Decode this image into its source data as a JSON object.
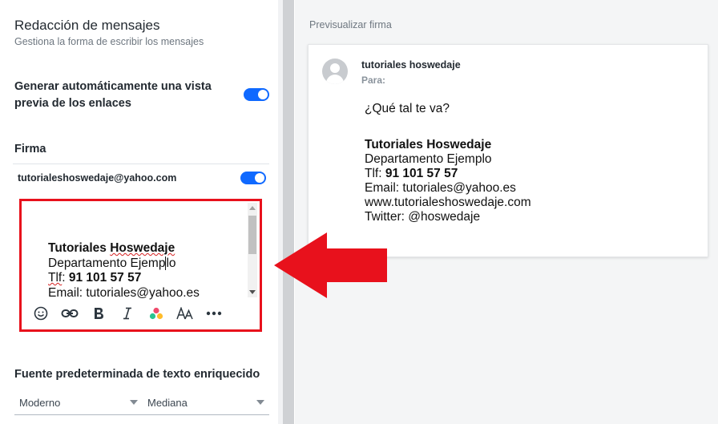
{
  "section": {
    "title": "Redacción de mensajes",
    "subtitle": "Gestiona la forma de escribir los mensajes"
  },
  "link_preview": {
    "label": "Generar automáticamente una vista previa de los enlaces",
    "enabled": true
  },
  "signature": {
    "heading": "Firma",
    "account": "tutorialeshoswedaje@yahoo.com",
    "enabled": true,
    "editor_lines": {
      "name_a": "Tutoriales ",
      "name_b": "Hoswedaje",
      "dept_a": "Departamento Ejemp",
      "dept_b": "lo",
      "phone_label": "Tlf",
      "phone_sep": ": ",
      "phone_value": "91 101 57 57",
      "email": "Email: tutoriales@yahoo.es"
    },
    "toolbar": [
      "emoji-icon",
      "link-icon",
      "bold-icon",
      "italic-icon",
      "color-icon",
      "font-size-icon",
      "more-icon"
    ],
    "highlight_color": "#e8111c"
  },
  "font_defaults": {
    "heading": "Fuente predeterminada de texto enriquecido",
    "family": "Moderno",
    "size": "Mediana"
  },
  "preview": {
    "heading": "Previsualizar firma",
    "from": "tutoriales hoswedaje",
    "to_label": "Para:",
    "greeting": "¿Qué tal te va?",
    "signature": {
      "name": "Tutoriales Hoswedaje",
      "dept": "Departamento Ejemplo",
      "phone_label": "Tlf: ",
      "phone_value": "91 101 57 57",
      "email": "Email: tutoriales@yahoo.es",
      "web": "www.tutorialeshoswedaje.com",
      "twitter": "Twitter: @hoswedaje"
    }
  },
  "colors": {
    "toggle": "#0f69ff",
    "arrow": "#e8111c"
  }
}
